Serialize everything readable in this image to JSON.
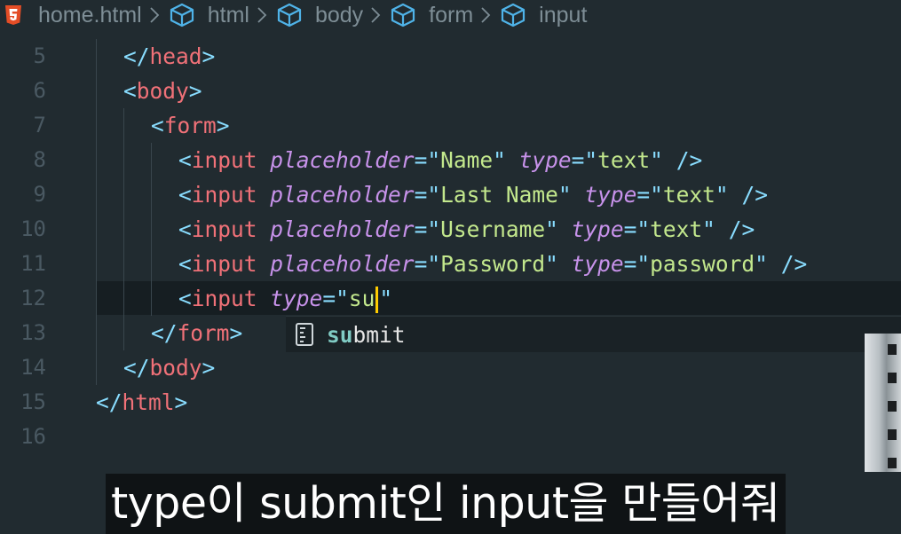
{
  "breadcrumb": {
    "items": [
      {
        "label": "home.html",
        "icon": "html5-icon"
      },
      {
        "label": "html",
        "icon": "cube-icon"
      },
      {
        "label": "body",
        "icon": "cube-icon"
      },
      {
        "label": "form",
        "icon": "cube-icon"
      },
      {
        "label": "input",
        "icon": "cube-icon"
      }
    ]
  },
  "editor": {
    "lines": [
      {
        "num": "5",
        "indent": 1,
        "tokens": [
          {
            "t": "bracket",
            "v": "</"
          },
          {
            "t": "tag",
            "v": "head"
          },
          {
            "t": "bracket",
            "v": ">"
          }
        ]
      },
      {
        "num": "6",
        "indent": 1,
        "tokens": [
          {
            "t": "bracket",
            "v": "<"
          },
          {
            "t": "tag",
            "v": "body"
          },
          {
            "t": "bracket",
            "v": ">"
          }
        ]
      },
      {
        "num": "7",
        "indent": 2,
        "tokens": [
          {
            "t": "bracket",
            "v": "<"
          },
          {
            "t": "tag",
            "v": "form"
          },
          {
            "t": "bracket",
            "v": ">"
          }
        ]
      },
      {
        "num": "8",
        "indent": 3,
        "tokens": [
          {
            "t": "bracket",
            "v": "<"
          },
          {
            "t": "tag",
            "v": "input"
          },
          {
            "t": "plain",
            "v": " "
          },
          {
            "t": "attr",
            "v": "placeholder"
          },
          {
            "t": "eq",
            "v": "=\""
          },
          {
            "t": "str",
            "v": "Name"
          },
          {
            "t": "quote",
            "v": "\""
          },
          {
            "t": "plain",
            "v": " "
          },
          {
            "t": "attr",
            "v": "type"
          },
          {
            "t": "eq",
            "v": "=\""
          },
          {
            "t": "str",
            "v": "text"
          },
          {
            "t": "quote",
            "v": "\""
          },
          {
            "t": "plain",
            "v": " "
          },
          {
            "t": "bracket",
            "v": "/>"
          }
        ]
      },
      {
        "num": "9",
        "indent": 3,
        "tokens": [
          {
            "t": "bracket",
            "v": "<"
          },
          {
            "t": "tag",
            "v": "input"
          },
          {
            "t": "plain",
            "v": " "
          },
          {
            "t": "attr",
            "v": "placeholder"
          },
          {
            "t": "eq",
            "v": "=\""
          },
          {
            "t": "str",
            "v": "Last Name"
          },
          {
            "t": "quote",
            "v": "\""
          },
          {
            "t": "plain",
            "v": " "
          },
          {
            "t": "attr",
            "v": "type"
          },
          {
            "t": "eq",
            "v": "=\""
          },
          {
            "t": "str",
            "v": "text"
          },
          {
            "t": "quote",
            "v": "\""
          },
          {
            "t": "plain",
            "v": " "
          },
          {
            "t": "bracket",
            "v": "/>"
          }
        ]
      },
      {
        "num": "10",
        "indent": 3,
        "tokens": [
          {
            "t": "bracket",
            "v": "<"
          },
          {
            "t": "tag",
            "v": "input"
          },
          {
            "t": "plain",
            "v": " "
          },
          {
            "t": "attr",
            "v": "placeholder"
          },
          {
            "t": "eq",
            "v": "=\""
          },
          {
            "t": "str",
            "v": "Username"
          },
          {
            "t": "quote",
            "v": "\""
          },
          {
            "t": "plain",
            "v": " "
          },
          {
            "t": "attr",
            "v": "type"
          },
          {
            "t": "eq",
            "v": "=\""
          },
          {
            "t": "str",
            "v": "text"
          },
          {
            "t": "quote",
            "v": "\""
          },
          {
            "t": "plain",
            "v": " "
          },
          {
            "t": "bracket",
            "v": "/>"
          }
        ]
      },
      {
        "num": "11",
        "indent": 3,
        "tokens": [
          {
            "t": "bracket",
            "v": "<"
          },
          {
            "t": "tag",
            "v": "input"
          },
          {
            "t": "plain",
            "v": " "
          },
          {
            "t": "attr",
            "v": "placeholder"
          },
          {
            "t": "eq",
            "v": "=\""
          },
          {
            "t": "str",
            "v": "Password"
          },
          {
            "t": "quote",
            "v": "\""
          },
          {
            "t": "plain",
            "v": " "
          },
          {
            "t": "attr",
            "v": "type"
          },
          {
            "t": "eq",
            "v": "=\""
          },
          {
            "t": "str",
            "v": "password"
          },
          {
            "t": "quote",
            "v": "\""
          },
          {
            "t": "plain",
            "v": " "
          },
          {
            "t": "bracket",
            "v": "/>"
          }
        ]
      },
      {
        "num": "12",
        "indent": 3,
        "active": true,
        "tokens": [
          {
            "t": "bracket",
            "v": "<"
          },
          {
            "t": "tag",
            "v": "input"
          },
          {
            "t": "plain",
            "v": " "
          },
          {
            "t": "attr",
            "v": "type"
          },
          {
            "t": "eq",
            "v": "=\""
          },
          {
            "t": "str",
            "v": "su"
          },
          {
            "t": "cursor",
            "v": ""
          },
          {
            "t": "quote",
            "v": "\""
          }
        ]
      },
      {
        "num": "13",
        "indent": 2,
        "tokens": [
          {
            "t": "bracket",
            "v": "</"
          },
          {
            "t": "tag",
            "v": "form"
          },
          {
            "t": "bracket",
            "v": ">"
          }
        ]
      },
      {
        "num": "14",
        "indent": 1,
        "tokens": [
          {
            "t": "bracket",
            "v": "</"
          },
          {
            "t": "tag",
            "v": "body"
          },
          {
            "t": "bracket",
            "v": ">"
          }
        ]
      },
      {
        "num": "15",
        "indent": 0,
        "tokens": [
          {
            "t": "bracket",
            "v": "</"
          },
          {
            "t": "tag",
            "v": "html"
          },
          {
            "t": "bracket",
            "v": ">"
          }
        ]
      },
      {
        "num": "16",
        "indent": 0,
        "tokens": []
      }
    ]
  },
  "suggest": {
    "icon": "ruler-icon",
    "match": "su",
    "rest": "bmit"
  },
  "caption": {
    "text": "type이 submit인 input을 만들어줘"
  },
  "colors": {
    "background": "#212b30",
    "tag": "#f07178",
    "bracket": "#89ddff",
    "attribute": "#c792ea",
    "string": "#c3e88d",
    "cursor": "#ffcc00"
  }
}
